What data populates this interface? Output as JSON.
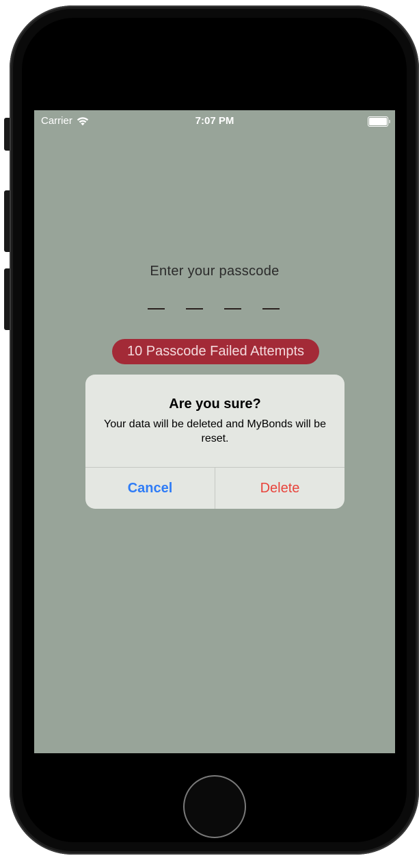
{
  "status_bar": {
    "carrier": "Carrier",
    "time": "7:07 PM",
    "wifi_icon": "wifi-icon",
    "battery_icon": "battery-full-icon"
  },
  "passcode": {
    "prompt": "Enter your passcode",
    "digit_count": 4,
    "failed_attempts_label": "10 Passcode Failed Attempts"
  },
  "alert": {
    "title": "Are you sure?",
    "message": "Your data will be deleted and MyBonds will be reset.",
    "cancel_label": "Cancel",
    "delete_label": "Delete"
  },
  "colors": {
    "screen_background": "#98a499",
    "badge_background": "#a32a37",
    "cancel_color": "#2f7cf6",
    "delete_color": "#e8443c"
  }
}
